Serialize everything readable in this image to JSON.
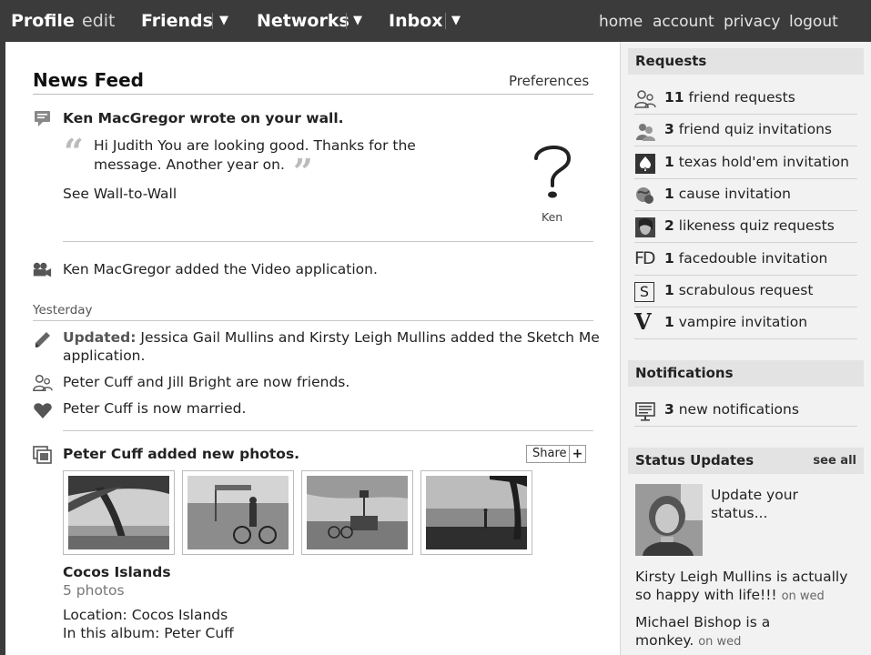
{
  "topnav": {
    "profile": "Profile",
    "edit": "edit",
    "friends": "Friends",
    "networks": "Networks",
    "inbox": "Inbox",
    "arrow": "▼",
    "home": "home",
    "account": "account",
    "privacy": "privacy",
    "logout": "logout"
  },
  "newsfeed": {
    "title": "News Feed",
    "preferences": "Preferences",
    "wall_story": {
      "actor": "Ken MacGregor wrote on your wall.",
      "quote_line1": "Hi Judith You are looking good. Thanks for the",
      "quote_line2": "message. Another year on.",
      "wall_to_wall": "See Wall-to-Wall",
      "avatar_caption": "Ken"
    },
    "video_story": {
      "actor": "Ken MacGregor",
      "text": "added the Video application."
    },
    "day_label": "Yesterday",
    "updated_story": {
      "label": "Updated:",
      "actor1": "Jessica Gail Mullins",
      "conj": "and",
      "actor2": "Kirsty Leigh Mullins",
      "text1": "added the",
      "app": "Sketch Me",
      "text2": "application."
    },
    "friends_story": {
      "actor1": "Peter Cuff",
      "conj": "and",
      "actor2": "Jill Bright",
      "text": "are now friends."
    },
    "married_story": {
      "actor": "Peter Cuff",
      "text": "is now married."
    },
    "photo_story": {
      "actor": "Peter Cuff added new photos.",
      "share": "Share",
      "share_plus": "+",
      "album_name": "Cocos Islands",
      "photo_count": "5 photos",
      "location_label": "Location:",
      "location": "Cocos Islands",
      "in_album_label": "In this album:",
      "in_album": "Peter Cuff"
    }
  },
  "requests": {
    "header": "Requests",
    "items": [
      {
        "count": "11",
        "label": "friend requests",
        "icon": "friends-icon"
      },
      {
        "count": "3",
        "label": "friend quiz invitations",
        "icon": "quiz-icon"
      },
      {
        "count": "1",
        "label": "texas hold'em invitation",
        "icon": "poker-spade-icon"
      },
      {
        "count": "1",
        "label": "cause invitation",
        "icon": "cause-icon"
      },
      {
        "count": "2",
        "label": "likeness quiz requests",
        "icon": "likeness-face-icon"
      },
      {
        "count": "1",
        "label": "facedouble invitation",
        "icon": "facedouble-icon",
        "glyph": "FD"
      },
      {
        "count": "1",
        "label": "scrabulous request",
        "icon": "scrabulous-icon",
        "glyph": "S"
      },
      {
        "count": "1",
        "label": "vampire invitation",
        "icon": "vampire-icon",
        "glyph": "V"
      }
    ]
  },
  "notifications": {
    "header": "Notifications",
    "count": "3",
    "label": "new notifications"
  },
  "status_updates": {
    "header": "Status Updates",
    "see_all": "see all",
    "update_prompt_line1": "Update your",
    "update_prompt_line2": "status...",
    "entries": [
      {
        "name": "Kirsty Leigh Mullins",
        "line1_rest": "is actually",
        "line2": "so happy with life!!!",
        "when": "on wed"
      },
      {
        "name": "Michael Bishop",
        "line1_rest": "is a",
        "line2": "monkey.",
        "when": "on wed"
      }
    ]
  }
}
